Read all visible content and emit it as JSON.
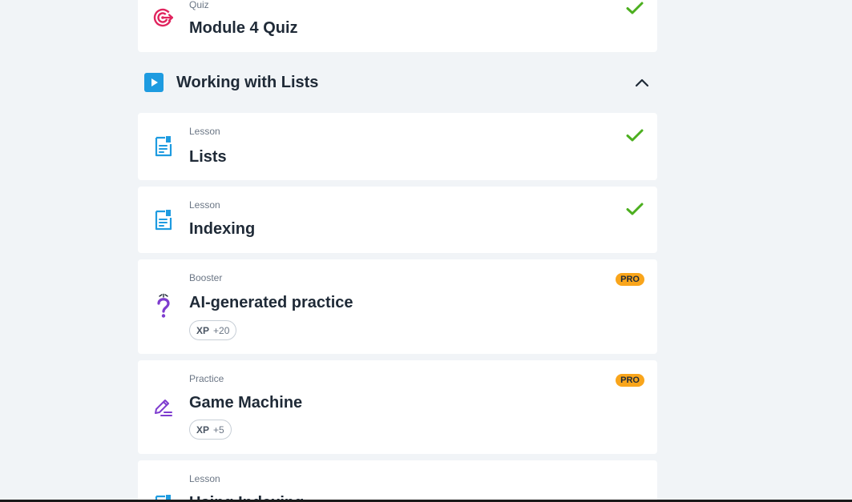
{
  "quiz_card": {
    "type": "Quiz",
    "title": "Module 4 Quiz"
  },
  "section": {
    "title": "Working with Lists"
  },
  "items": [
    {
      "type": "Lesson",
      "title": "Lists"
    },
    {
      "type": "Lesson",
      "title": "Indexing"
    },
    {
      "type": "Booster",
      "title": "AI-generated practice",
      "badge": "PRO",
      "xp_label": "XP",
      "xp_value": "+20"
    },
    {
      "type": "Practice",
      "title": "Game Machine",
      "badge": "PRO",
      "xp_label": "XP",
      "xp_value": "+5"
    },
    {
      "type": "Lesson",
      "title": "Using Indexing"
    }
  ],
  "colors": {
    "background": "#f1f4f7",
    "card": "#ffffff",
    "check": "#4caf1f",
    "quiz_icon": "#e0245e",
    "lesson_icon": "#1e9be0",
    "booster_icon": "#7e3ccf",
    "pro_badge": "#f9a51b",
    "section_icon": "#1e9be0"
  },
  "icons": {
    "quiz": "target-icon",
    "lesson": "document-icon",
    "booster": "question-sparkle-icon",
    "practice": "pencil-icon",
    "section": "play-icon",
    "collapse": "chevron-up-icon",
    "completed": "check-icon"
  }
}
